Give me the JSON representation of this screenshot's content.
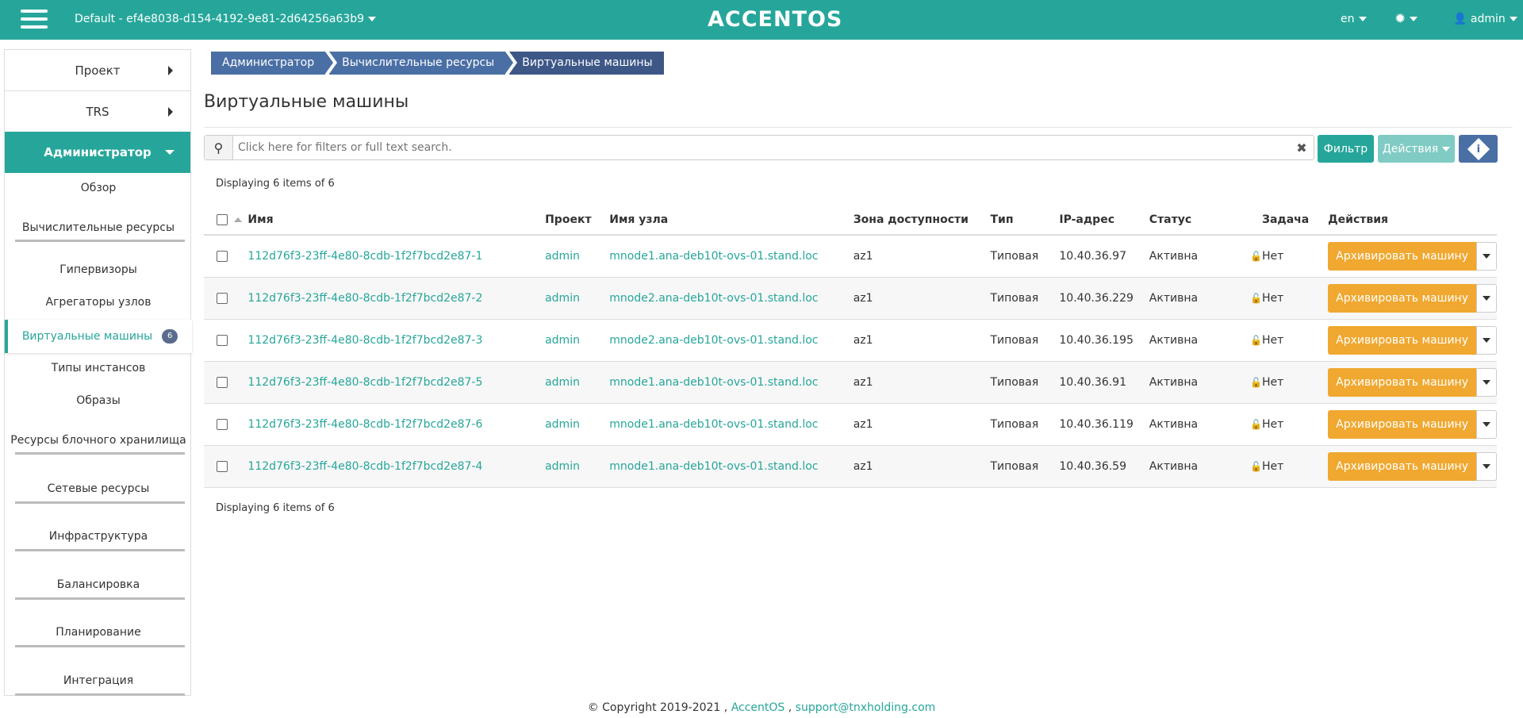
{
  "topbar": {
    "project_selector": "Default - ef4e8038-d154-4192-9e81-2d64256a63b9",
    "logo": "ACCENTOS",
    "lang": "en",
    "user": "admin"
  },
  "sidebar": {
    "project": "Проект",
    "trs": "TRS",
    "admin": "Администратор",
    "items": [
      "Обзор",
      "Вычислительные ресурсы",
      "Гипервизоры",
      "Агрегаторы узлов",
      "Виртуальные машины",
      "Типы инстансов",
      "Образы",
      "Ресурсы блочного хранилища",
      "Сетевые ресурсы",
      "Инфраструктура",
      "Балансировка",
      "Планирование",
      "Интеграция"
    ],
    "vm_count": "6"
  },
  "breadcrumb": [
    "Администратор",
    "Вычислительные ресурсы",
    "Виртуальные машины"
  ],
  "page_title": "Виртуальные машины",
  "search": {
    "placeholder": "Click here for filters or full text search."
  },
  "buttons": {
    "filter": "Фильтр",
    "actions": "Действия"
  },
  "displaying": "Displaying 6 items of 6",
  "table": {
    "headers": [
      "Имя",
      "Проект",
      "Имя узла",
      "Зона доступности",
      "Тип",
      "IP-адрес",
      "Статус",
      "Задача",
      "Действия"
    ],
    "rows": [
      {
        "name": "112d76f3-23ff-4e80-8cdb-1f2f7bcd2e87-1",
        "project": "admin",
        "host": "mnode1.ana-deb10t-ovs-01.stand.loc",
        "zone": "az1",
        "type": "Типовая",
        "ip": "10.40.36.97",
        "status": "Активна",
        "task": "Нет",
        "action": "Архивировать машину"
      },
      {
        "name": "112d76f3-23ff-4e80-8cdb-1f2f7bcd2e87-2",
        "project": "admin",
        "host": "mnode2.ana-deb10t-ovs-01.stand.loc",
        "zone": "az1",
        "type": "Типовая",
        "ip": "10.40.36.229",
        "status": "Активна",
        "task": "Нет",
        "action": "Архивировать машину"
      },
      {
        "name": "112d76f3-23ff-4e80-8cdb-1f2f7bcd2e87-3",
        "project": "admin",
        "host": "mnode2.ana-deb10t-ovs-01.stand.loc",
        "zone": "az1",
        "type": "Типовая",
        "ip": "10.40.36.195",
        "status": "Активна",
        "task": "Нет",
        "action": "Архивировать машину"
      },
      {
        "name": "112d76f3-23ff-4e80-8cdb-1f2f7bcd2e87-5",
        "project": "admin",
        "host": "mnode1.ana-deb10t-ovs-01.stand.loc",
        "zone": "az1",
        "type": "Типовая",
        "ip": "10.40.36.91",
        "status": "Активна",
        "task": "Нет",
        "action": "Архивировать машину"
      },
      {
        "name": "112d76f3-23ff-4e80-8cdb-1f2f7bcd2e87-6",
        "project": "admin",
        "host": "mnode1.ana-deb10t-ovs-01.stand.loc",
        "zone": "az1",
        "type": "Типовая",
        "ip": "10.40.36.119",
        "status": "Активна",
        "task": "Нет",
        "action": "Архивировать машину"
      },
      {
        "name": "112d76f3-23ff-4e80-8cdb-1f2f7bcd2e87-4",
        "project": "admin",
        "host": "mnode1.ana-deb10t-ovs-01.stand.loc",
        "zone": "az1",
        "type": "Типовая",
        "ip": "10.40.36.59",
        "status": "Активна",
        "task": "Нет",
        "action": "Архивировать машину"
      }
    ]
  },
  "footer": {
    "copyright": "© Copyright 2019-2021 ,",
    "brand": "AccentOS",
    "sep": ",",
    "email": "support@tnxholding.com"
  },
  "colors": {
    "accent": "#26a69a",
    "breadcrumb": "#4a6fa5",
    "archive_button": "#f0a830"
  }
}
